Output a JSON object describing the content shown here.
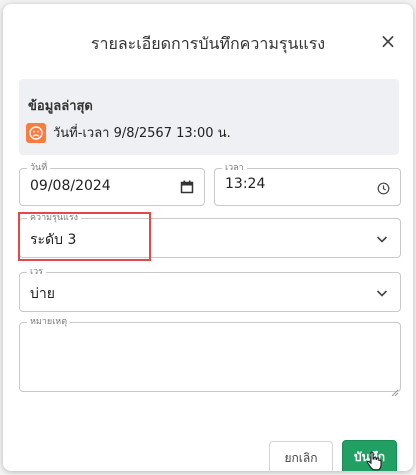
{
  "dialog": {
    "title": "รายละเอียดการบันทึกความรุนแรง",
    "close_label": "×"
  },
  "latest": {
    "title": "ข้อมูลล่าสุด",
    "icon": "sad-face-icon",
    "icon_color": "#ff7a3d",
    "datetime_text": "วันที่-เวลา 9/8/2567 13:00 น."
  },
  "form": {
    "date": {
      "label": "วันที่",
      "value": "09/08/2024",
      "icon": "calendar-icon"
    },
    "time": {
      "label": "เวลา",
      "value": "13:24",
      "icon": "clock-icon"
    },
    "severity": {
      "label": "ความรุนแรง",
      "value": "ระดับ 3",
      "icon": "chevron-down-icon"
    },
    "shift": {
      "label": "เวร",
      "value": "บ่าย",
      "icon": "chevron-down-icon"
    },
    "note": {
      "label": "หมายเหตุ",
      "value": ""
    }
  },
  "footer": {
    "cancel_label": "ยกเลิก",
    "save_label": "บันทึก",
    "save_color": "#22a064"
  },
  "colors": {
    "highlight": "#e04a4a",
    "info_panel_bg": "#eef0f3"
  }
}
